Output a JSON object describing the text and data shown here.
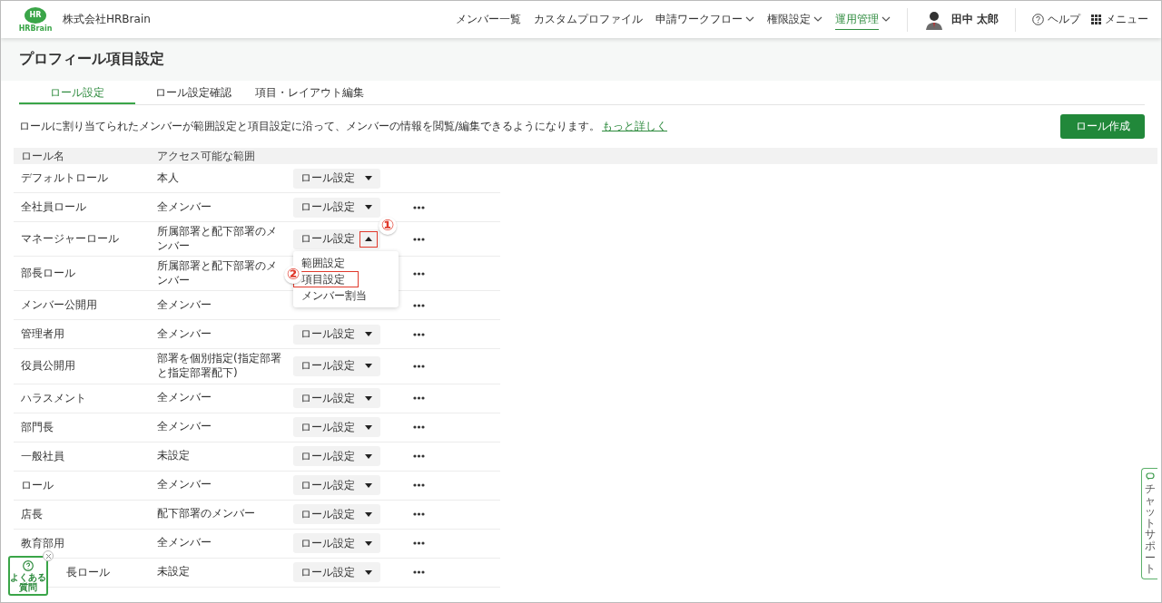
{
  "header": {
    "logo": {
      "mark": "HR",
      "wordmark": "HRBrain"
    },
    "company": "株式会社HRBrain",
    "nav": [
      {
        "label": "メンバー一覧",
        "dropdown": false,
        "selected": false
      },
      {
        "label": "カスタムプロファイル",
        "dropdown": false,
        "selected": false
      },
      {
        "label": "申請ワークフロー",
        "dropdown": true,
        "selected": false
      },
      {
        "label": "権限設定",
        "dropdown": true,
        "selected": false
      },
      {
        "label": "運用管理",
        "dropdown": true,
        "selected": true
      }
    ],
    "user": {
      "name": "田中 太郎"
    },
    "help": "ヘルプ",
    "menu": "メニュー"
  },
  "page_title": "プロフィール項目設定",
  "tabs": [
    {
      "label": "ロール設定",
      "selected": true
    },
    {
      "label": "ロール設定確認",
      "selected": false
    },
    {
      "label": "項目・レイアウト編集",
      "selected": false
    }
  ],
  "description": {
    "text": "ロールに割り当てられたメンバーが範囲設定と項目設定に沿って、メンバーの情報を閲覧/編集できるようになります。",
    "link": "もっと詳しく"
  },
  "create_button": "ロール作成",
  "table": {
    "columns": [
      "ロール名",
      "アクセス可能な範囲"
    ],
    "rows": [
      {
        "name": "デフォルトロール",
        "scope": "本人",
        "action": "ロール設定",
        "expanded": false,
        "more": false
      },
      {
        "name": "全社員ロール",
        "scope": "全メンバー",
        "action": "ロール設定",
        "expanded": false,
        "more": true
      },
      {
        "name": "マネージャーロール",
        "scope": "所属部署と配下部署のメンバー",
        "action": "ロール設定",
        "expanded": true,
        "more": true,
        "callout": "①",
        "menu": [
          {
            "label": "範囲設定",
            "highlighted": false
          },
          {
            "label": "項目設定",
            "highlighted": true,
            "callout": "②"
          },
          {
            "label": "メンバー割当",
            "highlighted": false
          }
        ]
      },
      {
        "name": "部長ロール",
        "scope": "所属部署と配下部署のメンバー",
        "more": true
      },
      {
        "name": "メンバー公開用",
        "scope": "全メンバー",
        "more": true
      },
      {
        "name": "管理者用",
        "scope": "全メンバー",
        "action": "ロール設定",
        "expanded": false,
        "more": true
      },
      {
        "name": "役員公開用",
        "scope": "部署を個別指定(指定部署と指定部署配下)",
        "action": "ロール設定",
        "expanded": false,
        "more": true
      },
      {
        "name": "ハラスメント",
        "scope": "全メンバー",
        "action": "ロール設定",
        "expanded": false,
        "more": true
      },
      {
        "name": "部門長",
        "scope": "全メンバー",
        "action": "ロール設定",
        "expanded": false,
        "more": true
      },
      {
        "name": "一般社員",
        "scope": "未設定",
        "action": "ロール設定",
        "expanded": false,
        "more": true
      },
      {
        "name": "ロール",
        "scope": "全メンバー",
        "action": "ロール設定",
        "expanded": false,
        "more": true
      },
      {
        "name": "店長",
        "scope": "配下部署のメンバー",
        "action": "ロール設定",
        "expanded": false,
        "more": true
      },
      {
        "name": "教育部用",
        "scope": "全メンバー",
        "action": "ロール設定",
        "expanded": false,
        "more": true
      },
      {
        "name": "長ロール",
        "scope": "未設定",
        "action": "ロール設定",
        "expanded": false,
        "more": true,
        "covered": true
      }
    ]
  },
  "chat_support": "チャットサポート",
  "faq": "よくある質問"
}
